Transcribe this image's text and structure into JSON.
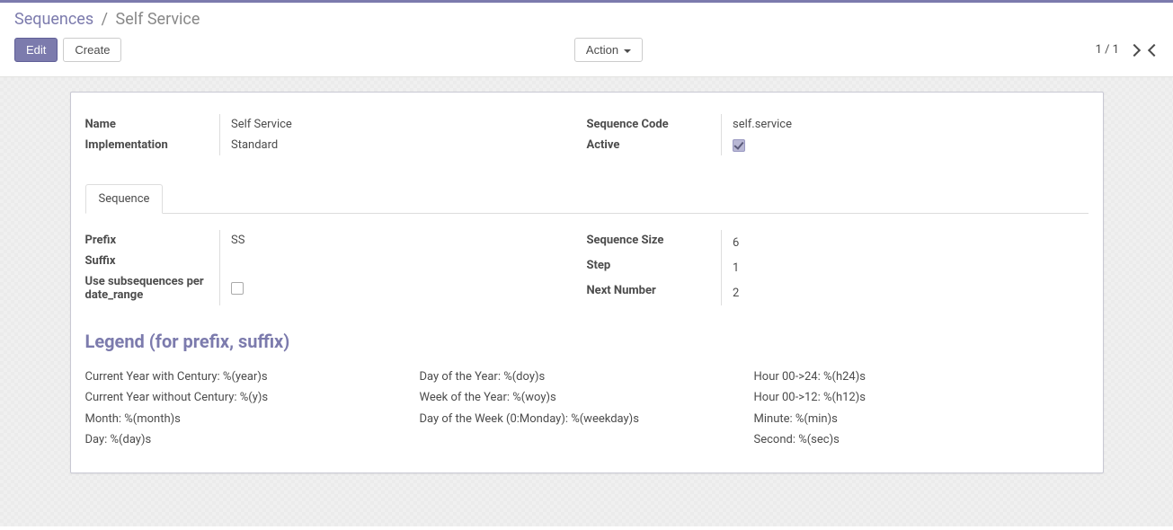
{
  "breadcrumb": {
    "parent": "Sequences",
    "sep": "/",
    "current": "Self Service"
  },
  "buttons": {
    "edit": "Edit",
    "create": "Create",
    "action": "Action"
  },
  "pager": {
    "text": "1 / 1"
  },
  "fields": {
    "name_label": "Name",
    "name_value": "Self Service",
    "impl_label": "Implementation",
    "impl_value": "Standard",
    "code_label": "Sequence Code",
    "code_value": "self.service",
    "active_label": "Active",
    "prefix_label": "Prefix",
    "prefix_value": "SS",
    "suffix_label": "Suffix",
    "suffix_value": "",
    "subseq_label": "Use subsequences per date_range",
    "size_label": "Sequence Size",
    "size_value": "6",
    "step_label": "Step",
    "step_value": "1",
    "next_label": "Next Number",
    "next_value": "2"
  },
  "tabs": {
    "sequence": "Sequence"
  },
  "legend": {
    "heading": "Legend (for prefix, suffix)",
    "col1": {
      "a": "Current Year with Century: %(year)s",
      "b": "Current Year without Century: %(y)s",
      "c": "Month: %(month)s",
      "d": "Day: %(day)s"
    },
    "col2": {
      "a": "Day of the Year: %(doy)s",
      "b": "Week of the Year: %(woy)s",
      "c": "Day of the Week (0:Monday): %(weekday)s"
    },
    "col3": {
      "a": "Hour 00->24: %(h24)s",
      "b": "Hour 00->12: %(h12)s",
      "c": "Minute: %(min)s",
      "d": "Second: %(sec)s"
    }
  }
}
